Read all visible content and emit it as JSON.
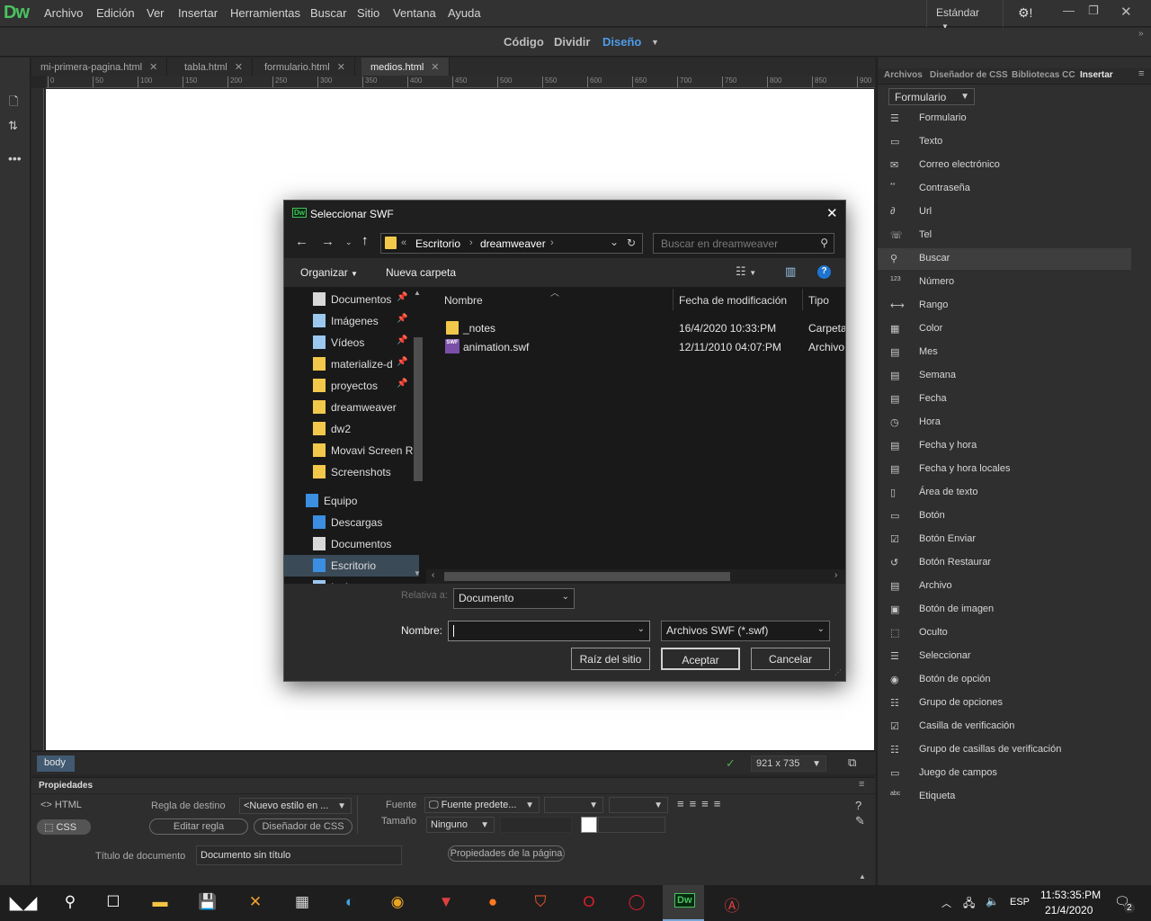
{
  "app": {
    "logo": "Dw"
  },
  "menu": [
    "Archivo",
    "Edición",
    "Ver",
    "Insertar",
    "Herramientas",
    "Buscar",
    "Sitio",
    "Ventana",
    "Ayuda"
  ],
  "workspace": "Estándar",
  "views": {
    "code": "Código",
    "split": "Dividir",
    "design": "Diseño"
  },
  "tabs": [
    "mi-primera-pagina.html",
    "tabla.html",
    "formulario.html",
    "medios.html"
  ],
  "ruler_labels": [
    "0",
    "50",
    "100",
    "150",
    "200",
    "250",
    "300",
    "350",
    "400",
    "450",
    "500",
    "550",
    "600",
    "650",
    "700",
    "750",
    "800",
    "850",
    "900"
  ],
  "status": {
    "tag": "body",
    "dimensions": "921 x 735"
  },
  "properties": {
    "title": "Propiedades",
    "html_label": "HTML",
    "css_label": "CSS",
    "target_rule_label": "Regla de destino",
    "target_rule_value": "<Nuevo estilo en ...",
    "edit_rule": "Editar regla",
    "css_designer": "Diseñador de CSS",
    "font_label": "Fuente",
    "font_value": "Fuente predete...",
    "size_label": "Tamaño",
    "size_value": "Ninguno",
    "doc_title_label": "Título de documento",
    "doc_title_value": "Documento sin título",
    "page_props": "Propiedades de la página"
  },
  "panel": {
    "tabs": [
      "Archivos",
      "Diseñador de CSS",
      "Bibliotecas CC",
      "Insertar"
    ],
    "category": "Formulario",
    "items": [
      {
        "label": "Formulario",
        "icon": "form-icon"
      },
      {
        "label": "Texto",
        "icon": "text-field-icon"
      },
      {
        "label": "Correo electrónico",
        "icon": "email-icon"
      },
      {
        "label": "Contraseña",
        "icon": "password-icon"
      },
      {
        "label": "Url",
        "icon": "url-icon"
      },
      {
        "label": "Tel",
        "icon": "phone-icon"
      },
      {
        "label": "Buscar",
        "icon": "search-icon"
      },
      {
        "label": "Número",
        "icon": "number-icon"
      },
      {
        "label": "Rango",
        "icon": "range-icon"
      },
      {
        "label": "Color",
        "icon": "color-icon"
      },
      {
        "label": "Mes",
        "icon": "month-icon"
      },
      {
        "label": "Semana",
        "icon": "week-icon"
      },
      {
        "label": "Fecha",
        "icon": "date-icon"
      },
      {
        "label": "Hora",
        "icon": "clock-icon"
      },
      {
        "label": "Fecha y hora",
        "icon": "datetime-icon"
      },
      {
        "label": "Fecha y hora locales",
        "icon": "datetime-local-icon"
      },
      {
        "label": "Área de texto",
        "icon": "textarea-icon"
      },
      {
        "label": "Botón",
        "icon": "button-icon"
      },
      {
        "label": "Botón Enviar",
        "icon": "submit-icon"
      },
      {
        "label": "Botón Restaurar",
        "icon": "reset-icon"
      },
      {
        "label": "Archivo",
        "icon": "file-icon"
      },
      {
        "label": "Botón de imagen",
        "icon": "image-button-icon"
      },
      {
        "label": "Oculto",
        "icon": "hidden-icon"
      },
      {
        "label": "Seleccionar",
        "icon": "select-icon"
      },
      {
        "label": "Botón de opción",
        "icon": "radio-icon"
      },
      {
        "label": "Grupo de opciones",
        "icon": "radio-group-icon"
      },
      {
        "label": "Casilla de verificación",
        "icon": "checkbox-icon"
      },
      {
        "label": "Grupo de casillas de verificación",
        "icon": "checkbox-group-icon"
      },
      {
        "label": "Juego de campos",
        "icon": "fieldset-icon"
      },
      {
        "label": "Etiqueta",
        "icon": "label-icon"
      }
    ]
  },
  "dialog": {
    "title": "Seleccionar SWF",
    "breadcrumb": [
      "«",
      "Escritorio",
      "dreamweaver"
    ],
    "search_placeholder": "Buscar en dreamweaver",
    "organize": "Organizar",
    "new_folder": "Nueva carpeta",
    "nav": [
      {
        "label": "Documentos",
        "icon": "documents-icon",
        "pinned": true
      },
      {
        "label": "Imágenes",
        "icon": "pictures-icon",
        "pinned": true
      },
      {
        "label": "Vídeos",
        "icon": "videos-icon",
        "pinned": true
      },
      {
        "label": "materialize-d",
        "icon": "folder-icon",
        "pinned": true
      },
      {
        "label": "proyectos",
        "icon": "folder-icon",
        "pinned": true
      },
      {
        "label": "dreamweaver",
        "icon": "folder-icon",
        "pinned": false
      },
      {
        "label": "dw2",
        "icon": "folder-icon",
        "pinned": false
      },
      {
        "label": "Movavi Screen R",
        "icon": "folder-icon",
        "pinned": false
      },
      {
        "label": "Screenshots",
        "icon": "folder-icon",
        "pinned": false
      }
    ],
    "computer": "Equipo",
    "computer_items": [
      {
        "label": "Descargas",
        "icon": "downloads-icon"
      },
      {
        "label": "Documentos",
        "icon": "documents-icon"
      },
      {
        "label": "Escritorio",
        "icon": "desktop-icon"
      },
      {
        "label": "Imágenes",
        "icon": "pictures-icon"
      }
    ],
    "columns": {
      "name": "Nombre",
      "modified": "Fecha de modificación",
      "type": "Tipo"
    },
    "files": [
      {
        "name": "_notes",
        "modified": "16/4/2020 10:33:PM",
        "type": "Carpeta",
        "icon": "folder-icon"
      },
      {
        "name": "animation.swf",
        "modified": "12/11/2010 04:07:PM",
        "type": "Archivo",
        "icon": "swf-file-icon"
      }
    ],
    "relative_label": "Relativa a:",
    "relative_value": "Documento",
    "name_label": "Nombre:",
    "name_value": "",
    "filter": "Archivos SWF (*.swf)",
    "site_root": "Raíz del sitio",
    "ok": "Aceptar",
    "cancel": "Cancelar"
  },
  "tray": {
    "lang": "ESP",
    "time": "11:53:35:PM",
    "date": "21/4/2020",
    "notifications": "2"
  }
}
